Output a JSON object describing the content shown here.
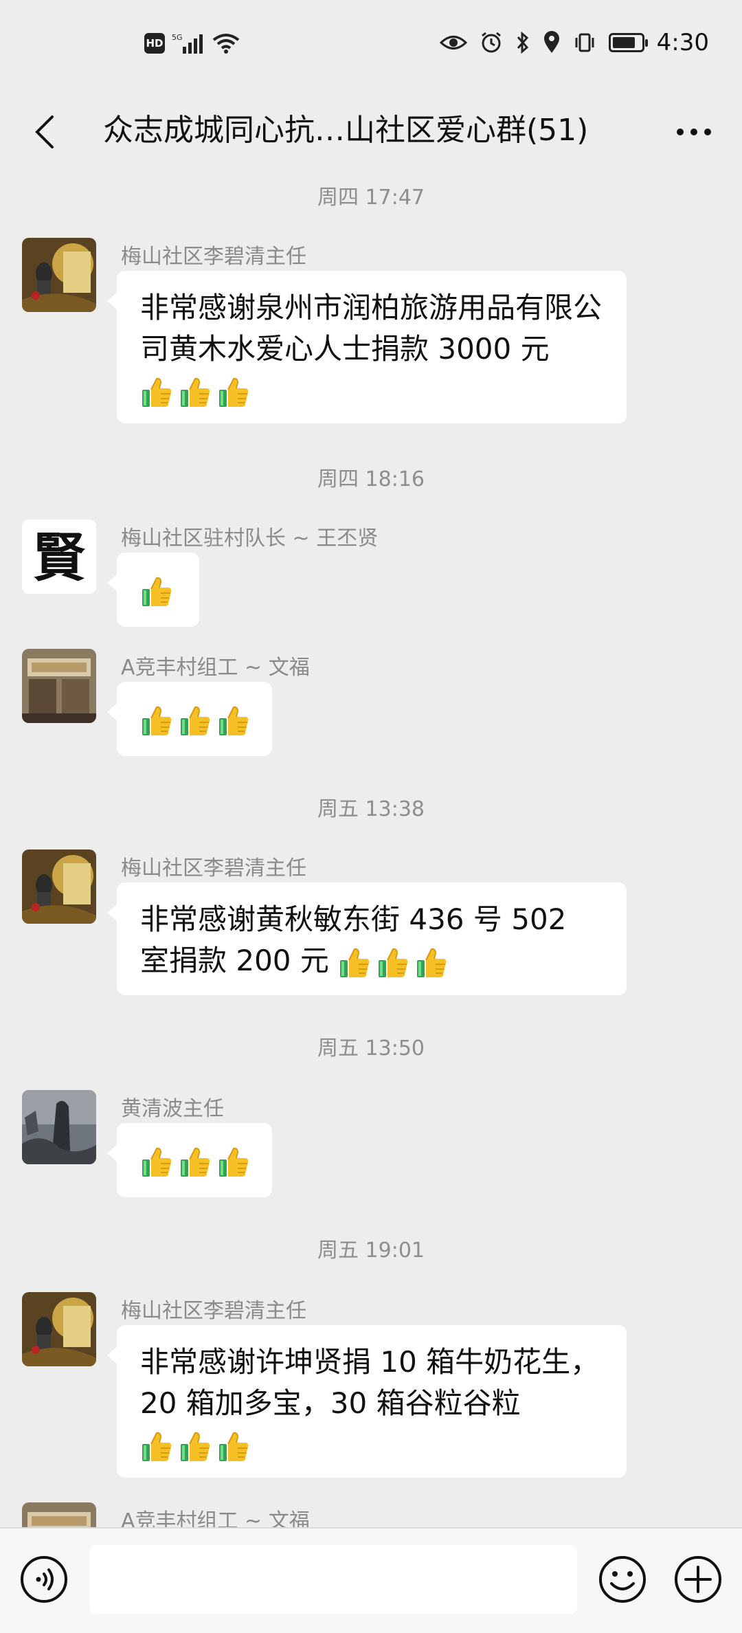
{
  "status_bar": {
    "network": "5G",
    "hd": "HD",
    "time": "4:30",
    "battery_level": 0.8
  },
  "header": {
    "title": "众志成城同心抗…山社区爱心群(51)"
  },
  "messages": [
    {
      "time": "周四 17:47",
      "sender": "梅山社区李碧清主任",
      "text": "非常感谢泉州市润柏旅游用品有限公司黄木水爱心人士捐款 3000 元",
      "thumbs": 3
    },
    {
      "time": "周四 18:16",
      "sender": "梅山社区驻村队长 ~ 王丕贤",
      "avatar_text": "賢",
      "text": "",
      "thumbs": 1
    },
    {
      "sender": "A竞丰村组工 ~ 文福",
      "text": "",
      "thumbs": 3
    },
    {
      "time": "周五 13:38",
      "sender": "梅山社区李碧清主任",
      "text": "非常感谢黄秋敏东街 436 号 502 室捐款 200 元",
      "thumbs": 3
    },
    {
      "time": "周五 13:50",
      "sender": "黄清波主任",
      "text": "",
      "thumbs": 3
    },
    {
      "time": "周五 19:01",
      "sender": "梅山社区李碧清主任",
      "text": "非常感谢许坤贤捐 10 箱牛奶花生，20 箱加多宝，30 箱谷粒谷粒",
      "thumbs": 3
    },
    {
      "sender": "A竞丰村组工 ~ 文福"
    }
  ],
  "input": {
    "placeholder": ""
  }
}
